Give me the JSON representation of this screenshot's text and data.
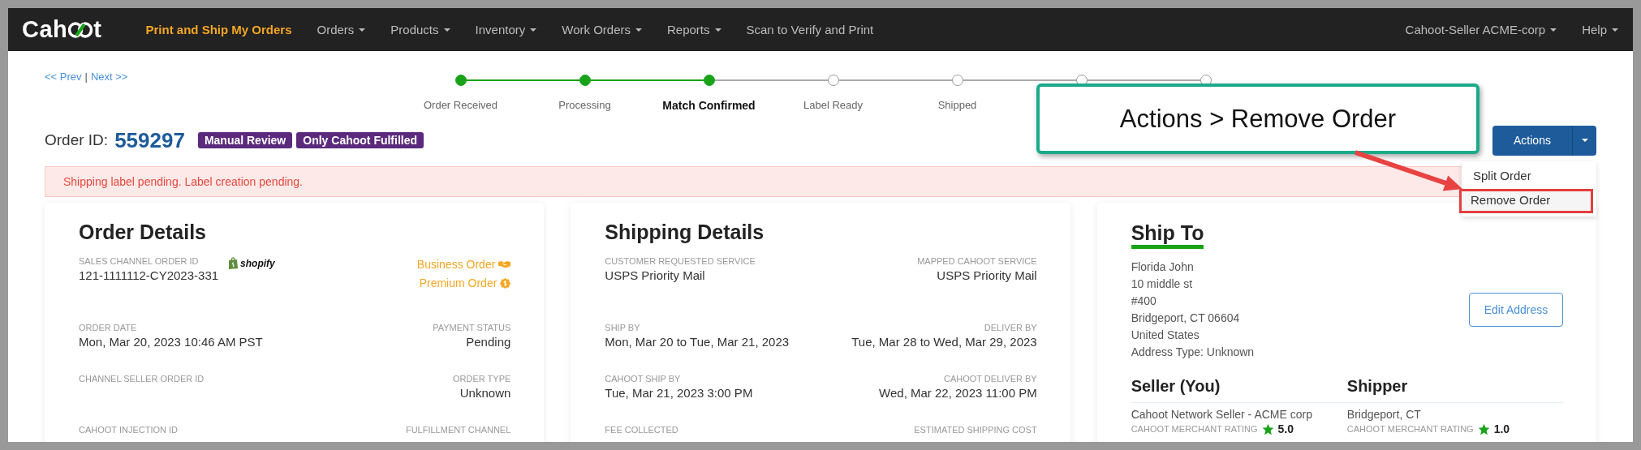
{
  "logo": {
    "before": "Cah",
    "after": "t"
  },
  "nav": {
    "items": [
      {
        "label": "Print and Ship My Orders",
        "selected": true,
        "has_menu": false
      },
      {
        "label": "Orders",
        "selected": false,
        "has_menu": true
      },
      {
        "label": "Products",
        "selected": false,
        "has_menu": true
      },
      {
        "label": "Inventory",
        "selected": false,
        "has_menu": true
      },
      {
        "label": "Work Orders",
        "selected": false,
        "has_menu": true
      },
      {
        "label": "Reports",
        "selected": false,
        "has_menu": true
      },
      {
        "label": "Scan to Verify and Print",
        "selected": false,
        "has_menu": false
      }
    ],
    "right_items": [
      {
        "label": "Cahoot-Seller ACME-corp",
        "has_menu": true
      },
      {
        "label": "Help",
        "has_menu": true
      }
    ]
  },
  "pager": {
    "prev": "<< Prev",
    "separator": "|",
    "next": "Next >>"
  },
  "steps": [
    {
      "label": "Order Received",
      "done": true,
      "current": false
    },
    {
      "label": "Processing",
      "done": true,
      "current": false
    },
    {
      "label": "Match Confirmed",
      "done": true,
      "current": true
    },
    {
      "label": "Label Ready",
      "done": false,
      "current": false
    },
    {
      "label": "Shipped",
      "done": false,
      "current": false
    },
    {
      "done": false
    },
    {
      "done": false
    }
  ],
  "order": {
    "label": "Order ID:",
    "number": "559297",
    "badges": [
      "Manual Review",
      "Only Cahoot Fulfilled"
    ]
  },
  "actions": {
    "label": "Actions",
    "menu": [
      {
        "label": "Split Order",
        "highlighted": false
      },
      {
        "label": "Remove Order",
        "highlighted": true
      }
    ]
  },
  "alert": "Shipping label pending. Label creation pending.",
  "callout": "Actions > Remove Order",
  "order_details": {
    "title": "Order Details",
    "fields": [
      {
        "kind": "field",
        "label": "SALES CHANNEL ORDER ID",
        "value": "121-1111112-CY2023-331",
        "channel": "shopify"
      },
      {
        "kind": "tags",
        "tags": [
          {
            "label": "Business Order"
          },
          {
            "label": "Premium Order"
          }
        ]
      },
      {
        "kind": "field",
        "label": "ORDER DATE",
        "value": "Mon, Mar 20, 2023 10:46 AM PST"
      },
      {
        "kind": "field",
        "label": "PAYMENT STATUS",
        "value": "Pending"
      },
      {
        "kind": "field",
        "label": "CHANNEL SELLER ORDER ID"
      },
      {
        "kind": "field",
        "label": "ORDER TYPE",
        "value": "Unknown"
      },
      {
        "kind": "field",
        "label": "CAHOOT INJECTION ID"
      },
      {
        "kind": "field",
        "label": "FULFILLMENT CHANNEL"
      }
    ]
  },
  "shipping_details": {
    "title": "Shipping Details",
    "fields": [
      {
        "kind": "field",
        "label": "CUSTOMER REQUESTED SERVICE",
        "value": "USPS Priority Mail"
      },
      {
        "kind": "field",
        "label": "MAPPED CAHOOT SERVICE",
        "value": "USPS Priority Mail"
      },
      {
        "kind": "field",
        "label": "SHIP BY",
        "value": "Mon, Mar 20 to Tue, Mar 21, 2023"
      },
      {
        "kind": "field",
        "label": "DELIVER BY",
        "value": "Tue, Mar 28 to Wed, Mar 29, 2023"
      },
      {
        "kind": "field",
        "label": "CAHOOT SHIP BY",
        "value": "Tue, Mar 21, 2023 3:00 PM"
      },
      {
        "kind": "field",
        "label": "CAHOOT DELIVER BY",
        "value": "Wed, Mar 22, 2023 11:00 PM"
      },
      {
        "kind": "field",
        "label": "FEE COLLECTED"
      },
      {
        "kind": "field",
        "label": "ESTIMATED SHIPPING COST"
      }
    ]
  },
  "ship_to": {
    "title": "Ship To",
    "lines": [
      "Florida John",
      "10 middle st",
      "#400",
      "Bridgeport, CT 06604",
      "United States",
      "Address Type: Unknown"
    ],
    "edit_button": "Edit Address",
    "parties": [
      {
        "heading": "Seller (You)",
        "name": "Cahoot Network Seller - ACME corp",
        "rating_label": "CAHOOT MERCHANT RATING",
        "rating": "5.0"
      },
      {
        "heading": "Shipper",
        "name": "Bridgeport, CT",
        "rating_label": "CAHOOT MERCHANT RATING",
        "rating": "1.0"
      }
    ]
  }
}
